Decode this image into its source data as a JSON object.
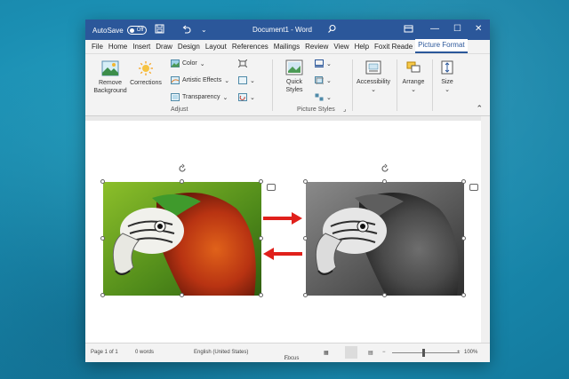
{
  "titlebar": {
    "autosave_label": "AutoSave",
    "autosave_state": "Off",
    "doc_title": "Document1 - Word"
  },
  "tabs": [
    "File",
    "Home",
    "Insert",
    "Draw",
    "Design",
    "Layout",
    "References",
    "Mailings",
    "Review",
    "View",
    "Help",
    "Foxit Reade",
    "Picture Format"
  ],
  "ribbon": {
    "remove_background": "Remove Background",
    "corrections": "Corrections",
    "color": "Color",
    "artistic_effects": "Artistic Effects",
    "transparency": "Transparency",
    "adjust_group": "Adjust",
    "quick_styles": "Quick Styles",
    "picture_styles_group": "Picture Styles",
    "accessibility": "Accessibility",
    "arrange": "Arrange",
    "size": "Size"
  },
  "status": {
    "page": "Page 1 of 1",
    "words": "0 words",
    "language": "English (United States)",
    "focus": "Focus",
    "zoom": "100%"
  },
  "colors": {
    "word_blue": "#2b579a",
    "arrow_red": "#e0201b"
  },
  "icons": [
    "save-icon",
    "undo-icon",
    "redo-icon",
    "search-icon",
    "minimize-icon",
    "maximize-icon",
    "close-icon"
  ]
}
